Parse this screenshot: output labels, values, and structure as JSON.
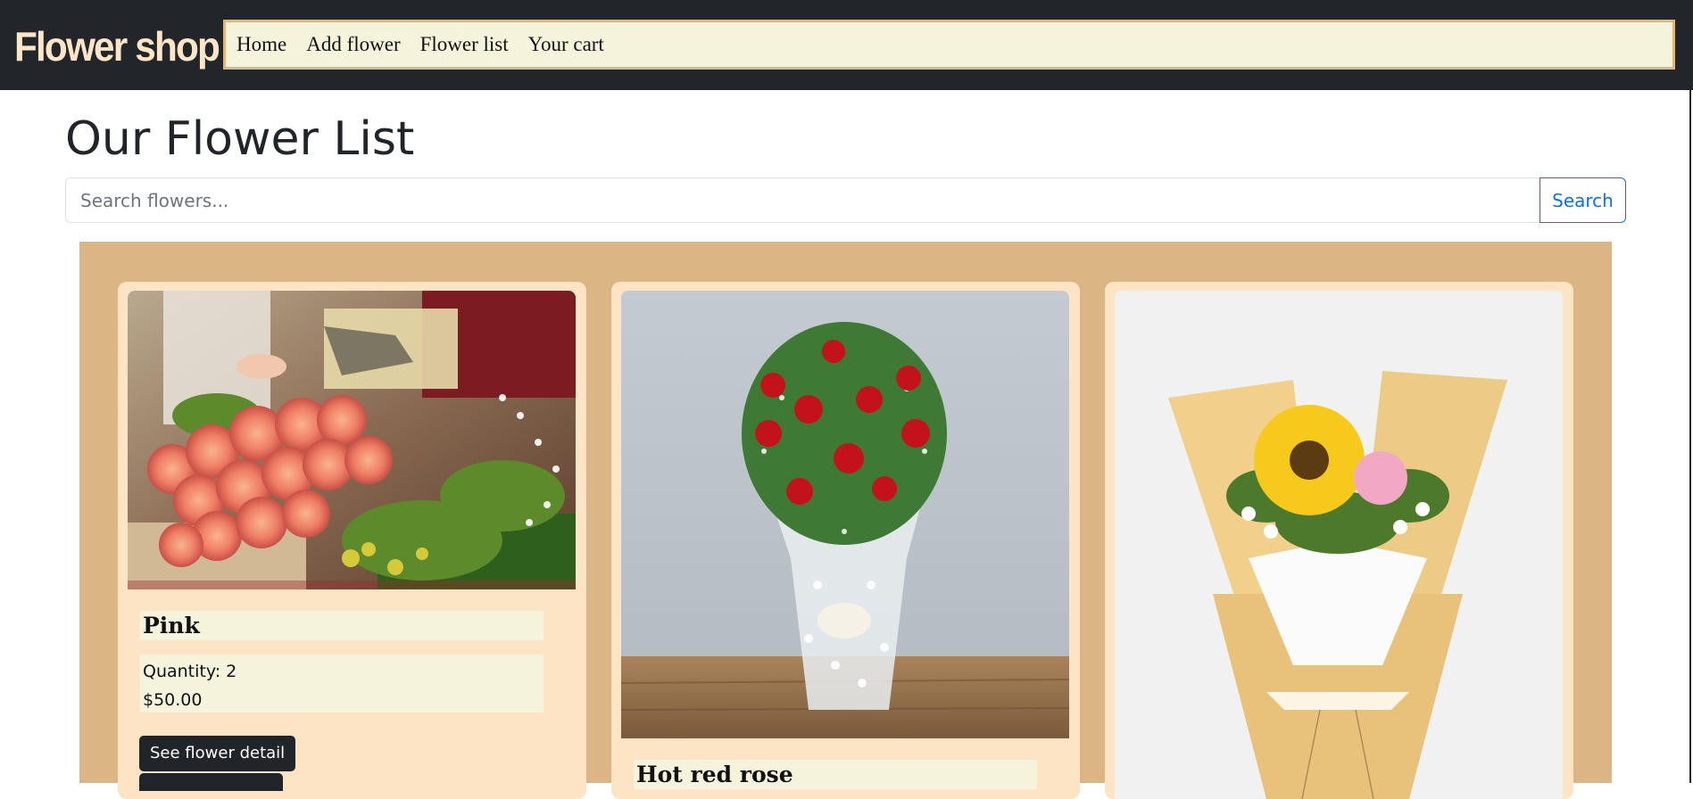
{
  "navbar": {
    "brand": "Flower shop",
    "links": [
      "Home",
      "Add flower",
      "Flower list",
      "Your cart"
    ]
  },
  "main": {
    "title": "Our Flower List",
    "search": {
      "placeholder": "Search flowers...",
      "value": "",
      "button_label": "Search"
    }
  },
  "cards": [
    {
      "name": "Pink",
      "quantity": "Quantity: 2",
      "price": "$50.00",
      "detail_label": "See flower detail",
      "image": "pink-roses-photo"
    },
    {
      "name": "Hot red rose",
      "image": "red-rose-bouquet-photo"
    },
    {
      "name": "",
      "image": "sunflower-bouquet-photo"
    }
  ],
  "colors": {
    "navbar_bg": "#22262b",
    "brand_text": "#fde6c8",
    "nav_box_bg": "#f5f3dc",
    "nav_box_border": "#dcb782",
    "grid_bg": "#dcb584",
    "card_bg": "#fde4c4",
    "search_accent": "#0d6efd",
    "button_dark": "#212529"
  }
}
